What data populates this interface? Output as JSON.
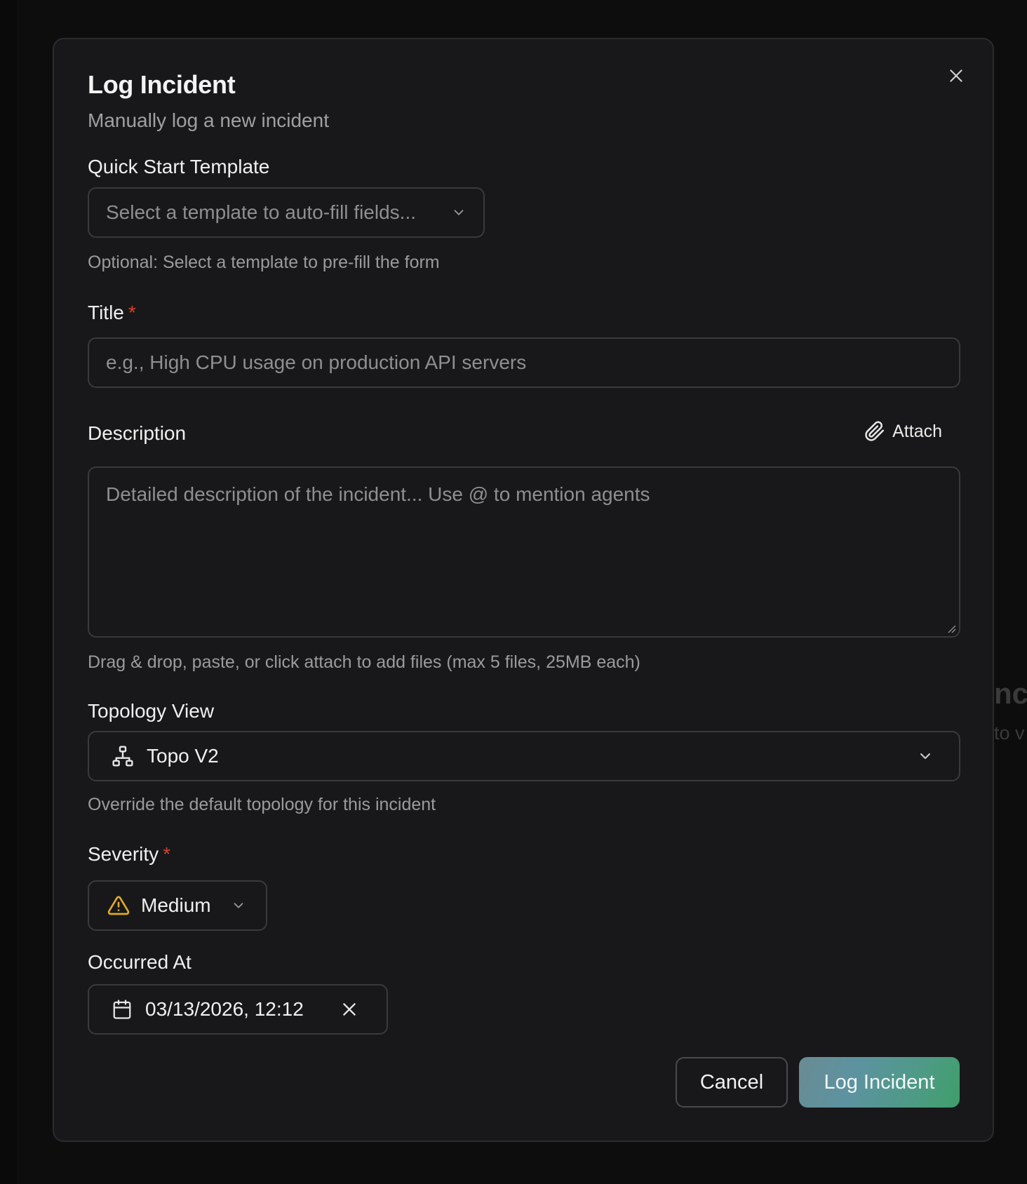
{
  "background": {
    "fragment_1": "nci",
    "fragment_2": "to v"
  },
  "dialog": {
    "title": "Log Incident",
    "subtitle": "Manually log a new incident",
    "close_icon": "close-icon"
  },
  "template": {
    "label": "Quick Start Template",
    "placeholder": "Select a template to auto-fill fields...",
    "help": "Optional: Select a template to pre-fill the form"
  },
  "title_field": {
    "label": "Title",
    "required_mark": "*",
    "value": "",
    "placeholder": "e.g., High CPU usage on production API servers"
  },
  "description": {
    "label": "Description",
    "attach_label": "Attach",
    "value": "",
    "placeholder": "Detailed description of the incident... Use @ to mention agents",
    "help": "Drag & drop, paste, or click attach to add files (max 5 files, 25MB each)"
  },
  "topology": {
    "label": "Topology View",
    "value": "Topo V2",
    "help": "Override the default topology for this incident"
  },
  "severity": {
    "label": "Severity",
    "required_mark": "*",
    "value": "Medium",
    "icon_color": "#e0a92c"
  },
  "occurred_at": {
    "label": "Occurred At",
    "value": "03/13/2026, 12:12"
  },
  "actions": {
    "cancel": "Cancel",
    "submit": "Log Incident"
  },
  "colors": {
    "required": "#d9402b",
    "accent_gradient_start": "#6a8b94",
    "accent_gradient_end": "#3f9f6a"
  }
}
